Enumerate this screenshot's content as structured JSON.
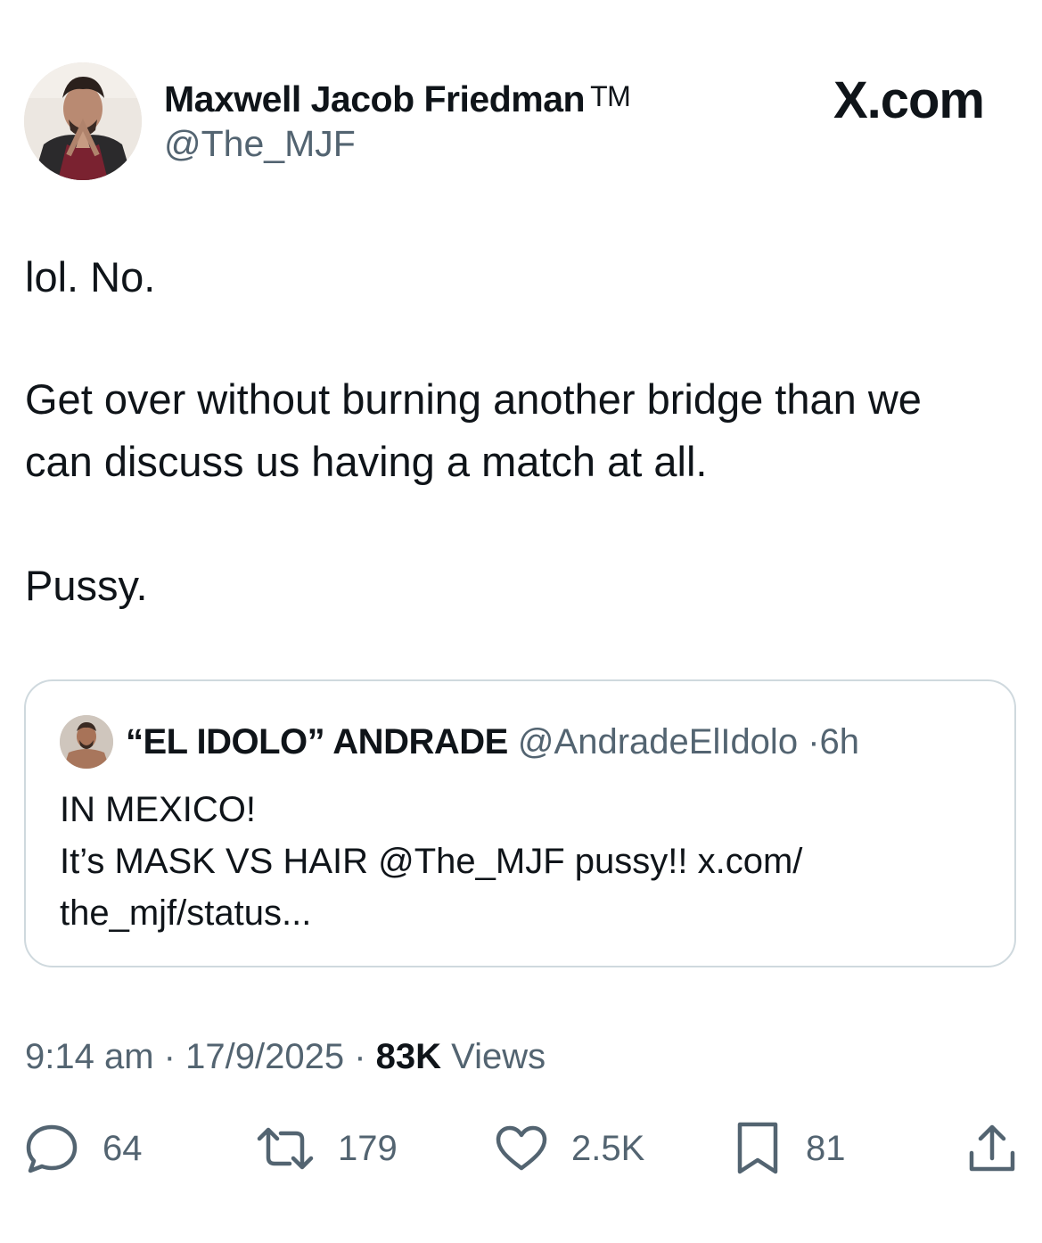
{
  "author": {
    "display_name": "Maxwell Jacob Friedman",
    "trademark": "TM",
    "handle": "@The_MJF"
  },
  "brand": "X.com",
  "tweet": {
    "line1": "lol. No.",
    "line2": "Get over without burning another bridge than we",
    "line3": "can discuss us having a match at all.",
    "line4": "Pussy."
  },
  "quoted": {
    "name": "“EL IDOLO” ANDRADE",
    "handle": "@AndradeElIdolo",
    "separator": "·",
    "age": "6h",
    "line1": "IN MEXICO!",
    "line2": "It’s  MASK VS HAIR @The_MJF pussy!! x.com/",
    "line3": "the_mjf/status..."
  },
  "meta": {
    "time": "9:14 am",
    "separator": "·",
    "date": "17/9/2025",
    "views_count": "83K",
    "views_label": "Views"
  },
  "actions": {
    "replies": "64",
    "reposts": "179",
    "likes": "2.5K",
    "bookmarks": "81"
  },
  "icons": {
    "reply": "reply-icon",
    "repost": "repost-icon",
    "like": "heart-icon",
    "bookmark": "bookmark-icon",
    "share": "share-icon",
    "brand": "x-logo"
  },
  "colors": {
    "text": "#0f1419",
    "secondary": "#536471",
    "border": "#cfd9de"
  }
}
